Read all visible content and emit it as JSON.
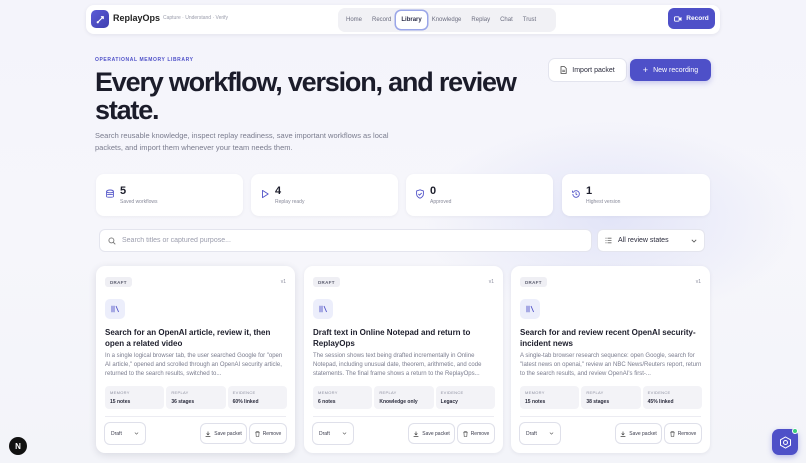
{
  "nav": {
    "brand": "ReplayOps",
    "tagline": "Capture · Understand · Verify",
    "links": [
      "Home",
      "Record",
      "Library",
      "Knowledge",
      "Replay",
      "Chat",
      "Trust"
    ],
    "active": "Library",
    "record_label": "Record"
  },
  "hero": {
    "eyebrow": "OPERATIONAL MEMORY LIBRARY",
    "title": "Every workflow, version, and review state.",
    "subtitle": "Search reusable knowledge, inspect replay readiness, save important workflows as local packets, and import them whenever your team needs them.",
    "import_label": "Import packet",
    "new_recording_label": "New recording"
  },
  "stats": [
    {
      "value": "5",
      "label": "Saved workflows",
      "icon": "database-icon"
    },
    {
      "value": "4",
      "label": "Replay ready",
      "icon": "play-icon"
    },
    {
      "value": "0",
      "label": "Approved",
      "icon": "shield-check-icon"
    },
    {
      "value": "1",
      "label": "Highest version",
      "icon": "history-icon"
    }
  ],
  "search": {
    "placeholder": "Search titles or captured purpose...",
    "filter_label": "All review states"
  },
  "cards": [
    {
      "badge": "DRAFT",
      "version": "v1",
      "title": "Search for an OpenAI article, review it, then open a related video",
      "description": "In a single logical browser tab, the user searched Google for \"open AI article,\" opened and scrolled through an OpenAI security article, returned to the search results, switched to...",
      "metrics": [
        {
          "key": "MEMORY",
          "value": "15 notes"
        },
        {
          "key": "REPLAY",
          "value": "36 stages"
        },
        {
          "key": "EVIDENCE",
          "value": "60% linked"
        }
      ],
      "status": "Draft",
      "save_label": "Save packet",
      "remove_label": "Remove"
    },
    {
      "badge": "DRAFT",
      "version": "v1",
      "title": "Draft text in Online Notepad and return to ReplayOps",
      "description": "The session shows text being drafted incrementally in Online Notepad, including unusual date, theorem, arithmetic, and code statements. The final frame shows a return to the ReplayOps...",
      "metrics": [
        {
          "key": "MEMORY",
          "value": "6 notes"
        },
        {
          "key": "REPLAY",
          "value": "Knowledge only"
        },
        {
          "key": "EVIDENCE",
          "value": "Legacy"
        }
      ],
      "status": "Draft",
      "save_label": "Save packet",
      "remove_label": "Remove"
    },
    {
      "badge": "DRAFT",
      "version": "v1",
      "title": "Search for and review recent OpenAI security-incident news",
      "description": "A single-tab browser research sequence: open Google, search for \"latest news on openai,\" review an NBC News/Reuters report, return to the search results, and review OpenAI's first-...",
      "metrics": [
        {
          "key": "MEMORY",
          "value": "15 notes"
        },
        {
          "key": "REPLAY",
          "value": "38 stages"
        },
        {
          "key": "EVIDENCE",
          "value": "45% linked"
        }
      ],
      "status": "Draft",
      "save_label": "Save packet",
      "remove_label": "Remove"
    }
  ],
  "floating": {
    "n_label": "N"
  },
  "colors": {
    "accent": "#4e50c8",
    "background": "#f4f4fb",
    "card": "#ffffff"
  }
}
